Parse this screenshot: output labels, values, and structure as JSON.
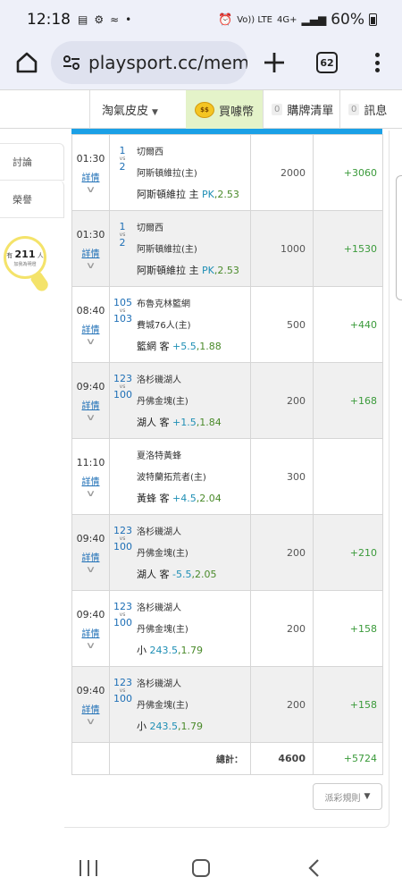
{
  "status_bar": {
    "time": "12:18",
    "left_icons": [
      "suitcase-icon",
      "gear-icon",
      "signal-slash-icon",
      "dot-icon"
    ],
    "network_labels": [
      "Vo)) LTE",
      "4G+"
    ],
    "battery": "60%"
  },
  "browser": {
    "url": "playsport.cc/membe",
    "tab_count": "62"
  },
  "site_nav": {
    "user_name": "淘氣皮皮",
    "coin_label": "買噱幣",
    "cart_count": "0",
    "cart_label": "購牌清單",
    "msg_count": "0",
    "msg_label": "訊息"
  },
  "side_panel": {
    "items": [
      {
        "label": "討論"
      },
      {
        "label": "榮譽"
      }
    ],
    "bulb": {
      "prefix": "有",
      "count": "211",
      "suffix": "人",
      "subtitle": "加我為明燈"
    }
  },
  "table": {
    "detail_label": "詳情",
    "rows": [
      {
        "time": "01:30",
        "num_a": "1",
        "num_b": "2",
        "team_a": "切爾西",
        "team_b": "阿斯頓維拉(主)",
        "pick_prefix": "阿斯頓維拉 主",
        "pick_value": "PK",
        "pick_odds": "2.53",
        "amount": "2000",
        "win": "+3060",
        "alt": false
      },
      {
        "time": "01:30",
        "num_a": "1",
        "num_b": "2",
        "team_a": "切爾西",
        "team_b": "阿斯頓維拉(主)",
        "pick_prefix": "阿斯頓維拉 主",
        "pick_value": "PK",
        "pick_odds": "2.53",
        "amount": "1000",
        "win": "+1530",
        "alt": true
      },
      {
        "time": "08:40",
        "num_a": "105",
        "num_b": "103",
        "team_a": "布魯克林籃網",
        "team_b": "費城76人(主)",
        "pick_prefix": "籃網 客",
        "pick_value": "+5.5",
        "pick_odds": "1.88",
        "amount": "500",
        "win": "+440",
        "alt": false
      },
      {
        "time": "09:40",
        "num_a": "123",
        "num_b": "100",
        "team_a": "洛杉磯湖人",
        "team_b": "丹佛金塊(主)",
        "pick_prefix": "湖人 客",
        "pick_value": "+1.5",
        "pick_odds": "1.84",
        "amount": "200",
        "win": "+168",
        "alt": true
      },
      {
        "time": "11:10",
        "num_a": "",
        "num_b": "",
        "team_a": "夏洛特黃蜂",
        "team_b": "波特蘭拓荒者(主)",
        "pick_prefix": "黃蜂 客",
        "pick_value": "+4.5",
        "pick_odds": "2.04",
        "amount": "300",
        "win": "",
        "alt": false
      },
      {
        "time": "09:40",
        "num_a": "123",
        "num_b": "100",
        "team_a": "洛杉磯湖人",
        "team_b": "丹佛金塊(主)",
        "pick_prefix": "湖人 客",
        "pick_value": "-5.5",
        "pick_odds": "2.05",
        "amount": "200",
        "win": "+210",
        "alt": true
      },
      {
        "time": "09:40",
        "num_a": "123",
        "num_b": "100",
        "team_a": "洛杉磯湖人",
        "team_b": "丹佛金塊(主)",
        "pick_prefix": "小",
        "pick_value": "243.5",
        "pick_odds": "1.79",
        "amount": "200",
        "win": "+158",
        "alt": false
      },
      {
        "time": "09:40",
        "num_a": "123",
        "num_b": "100",
        "team_a": "洛杉磯湖人",
        "team_b": "丹佛金塊(主)",
        "pick_prefix": "小",
        "pick_value": "243.5",
        "pick_odds": "1.79",
        "amount": "200",
        "win": "+158",
        "alt": true
      }
    ],
    "total_label": "總計：",
    "total_amount": "4600",
    "total_win": "+5724"
  },
  "rules_button": "派彩規則",
  "colors": {
    "accent_blue": "#1ba0e6",
    "win_green": "#3a9a3a",
    "coin_bg": "#e4f3c9",
    "link_blue": "#1e6fb6"
  }
}
